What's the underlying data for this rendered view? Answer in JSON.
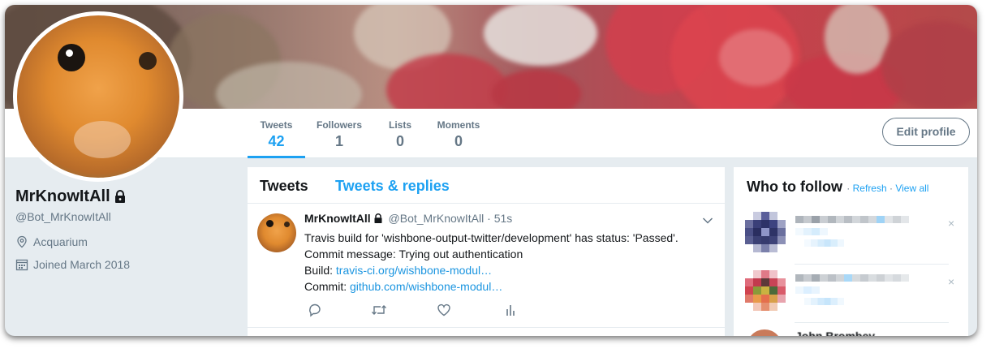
{
  "profile": {
    "name": "MrKnowItAll",
    "screen_name": "@Bot_MrKnowItAll",
    "location": "Acquarium",
    "joined": "Joined March 2018",
    "lock_icon": "lock-icon",
    "location_icon": "location-pin-icon",
    "calendar_icon": "calendar-icon"
  },
  "nav": {
    "stats": [
      {
        "label": "Tweets",
        "value": "42",
        "active": true
      },
      {
        "label": "Followers",
        "value": "1",
        "active": false
      },
      {
        "label": "Lists",
        "value": "0",
        "active": false
      },
      {
        "label": "Moments",
        "value": "0",
        "active": false
      }
    ],
    "edit_profile": "Edit profile"
  },
  "timeline": {
    "tabs": [
      "Tweets",
      "Tweets & replies"
    ],
    "tweet": {
      "fullname": "MrKnowItAll",
      "handle": "@Bot_MrKnowItAll",
      "time": "· 51s",
      "line1": "Travis build for 'wishbone-output-twitter/development' has status: 'Passed'.",
      "line2": "Commit message: Trying out authentication",
      "build_label": "Build: ",
      "build_link": "travis-ci.org/wishbone-modul…",
      "commit_label": "Commit: ",
      "commit_link": "github.com/wishbone-modul…"
    }
  },
  "who_to_follow": {
    "title": "Who to follow",
    "sep1": " · ",
    "refresh": "Refresh",
    "sep2": " · ",
    "view_all": "View all",
    "dismiss": "×",
    "third_name": "John Brombey"
  },
  "colors": {
    "accent": "#1da1f2",
    "link": "#1b95e0",
    "muted": "#657786",
    "background": "#e6ecf0"
  }
}
